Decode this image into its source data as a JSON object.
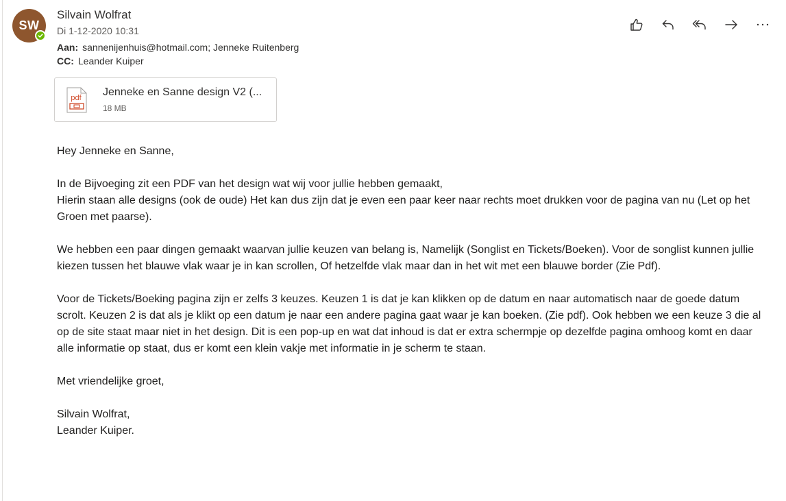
{
  "sender": {
    "initials": "SW",
    "name": "Silvain Wolfrat",
    "date": "Di 1-12-2020 10:31",
    "avatar_color": "#8e562e",
    "presence_color": "#6bb700"
  },
  "recipients": {
    "to_label": "Aan:",
    "to": "sannenijenhuis@hotmail.com; Jenneke Ruitenberg",
    "cc_label": "CC:",
    "cc": "Leander Kuiper"
  },
  "actions": [
    {
      "name": "like",
      "icon": "thumbs-up-icon"
    },
    {
      "name": "reply",
      "icon": "reply-icon"
    },
    {
      "name": "reply-all",
      "icon": "reply-all-icon"
    },
    {
      "name": "forward",
      "icon": "forward-icon"
    },
    {
      "name": "more",
      "icon": "more-options-icon"
    }
  ],
  "attachment": {
    "icon": "pdf-file-icon",
    "icon_label": "pdf",
    "name": "Jenneke en Sanne design V2 (...",
    "size": "18 MB"
  },
  "body": {
    "greeting": "Hey Jenneke en Sanne,",
    "p1_line1": "In de Bijvoeging zit een PDF van het design wat wij voor jullie hebben gemaakt,",
    "p1_line2": "Hierin staan alle designs (ook de oude) Het kan dus zijn dat je even een paar keer naar rechts moet drukken voor de pagina van nu (Let op het Groen met paarse).",
    "p2": "We hebben een paar dingen gemaakt waarvan jullie keuzen van belang is, Namelijk (Songlist en Tickets/Boeken). Voor de songlist kunnen jullie kiezen tussen het blauwe vlak waar je in kan scrollen, Of hetzelfde vlak maar dan in het wit met een blauwe border (Zie Pdf).",
    "p3": "Voor de Tickets/Boeking pagina zijn er zelfs 3 keuzes. Keuzen 1 is dat je kan klikken op de datum en naar automatisch naar de goede datum scrolt. Keuzen 2 is dat als je klikt op een datum je naar een andere pagina gaat waar je kan boeken. (Zie pdf). Ook hebben we een keuze 3 die al op de site staat maar niet in het design. Dit is een pop-up en wat dat inhoud is dat er extra schermpje op dezelfde pagina omhoog komt en daar alle informatie op staat, dus er komt een klein vakje met informatie in je scherm te staan.",
    "closing": "Met vriendelijke groet,",
    "sign1": "Silvain Wolfrat,",
    "sign2": "Leander Kuiper."
  }
}
